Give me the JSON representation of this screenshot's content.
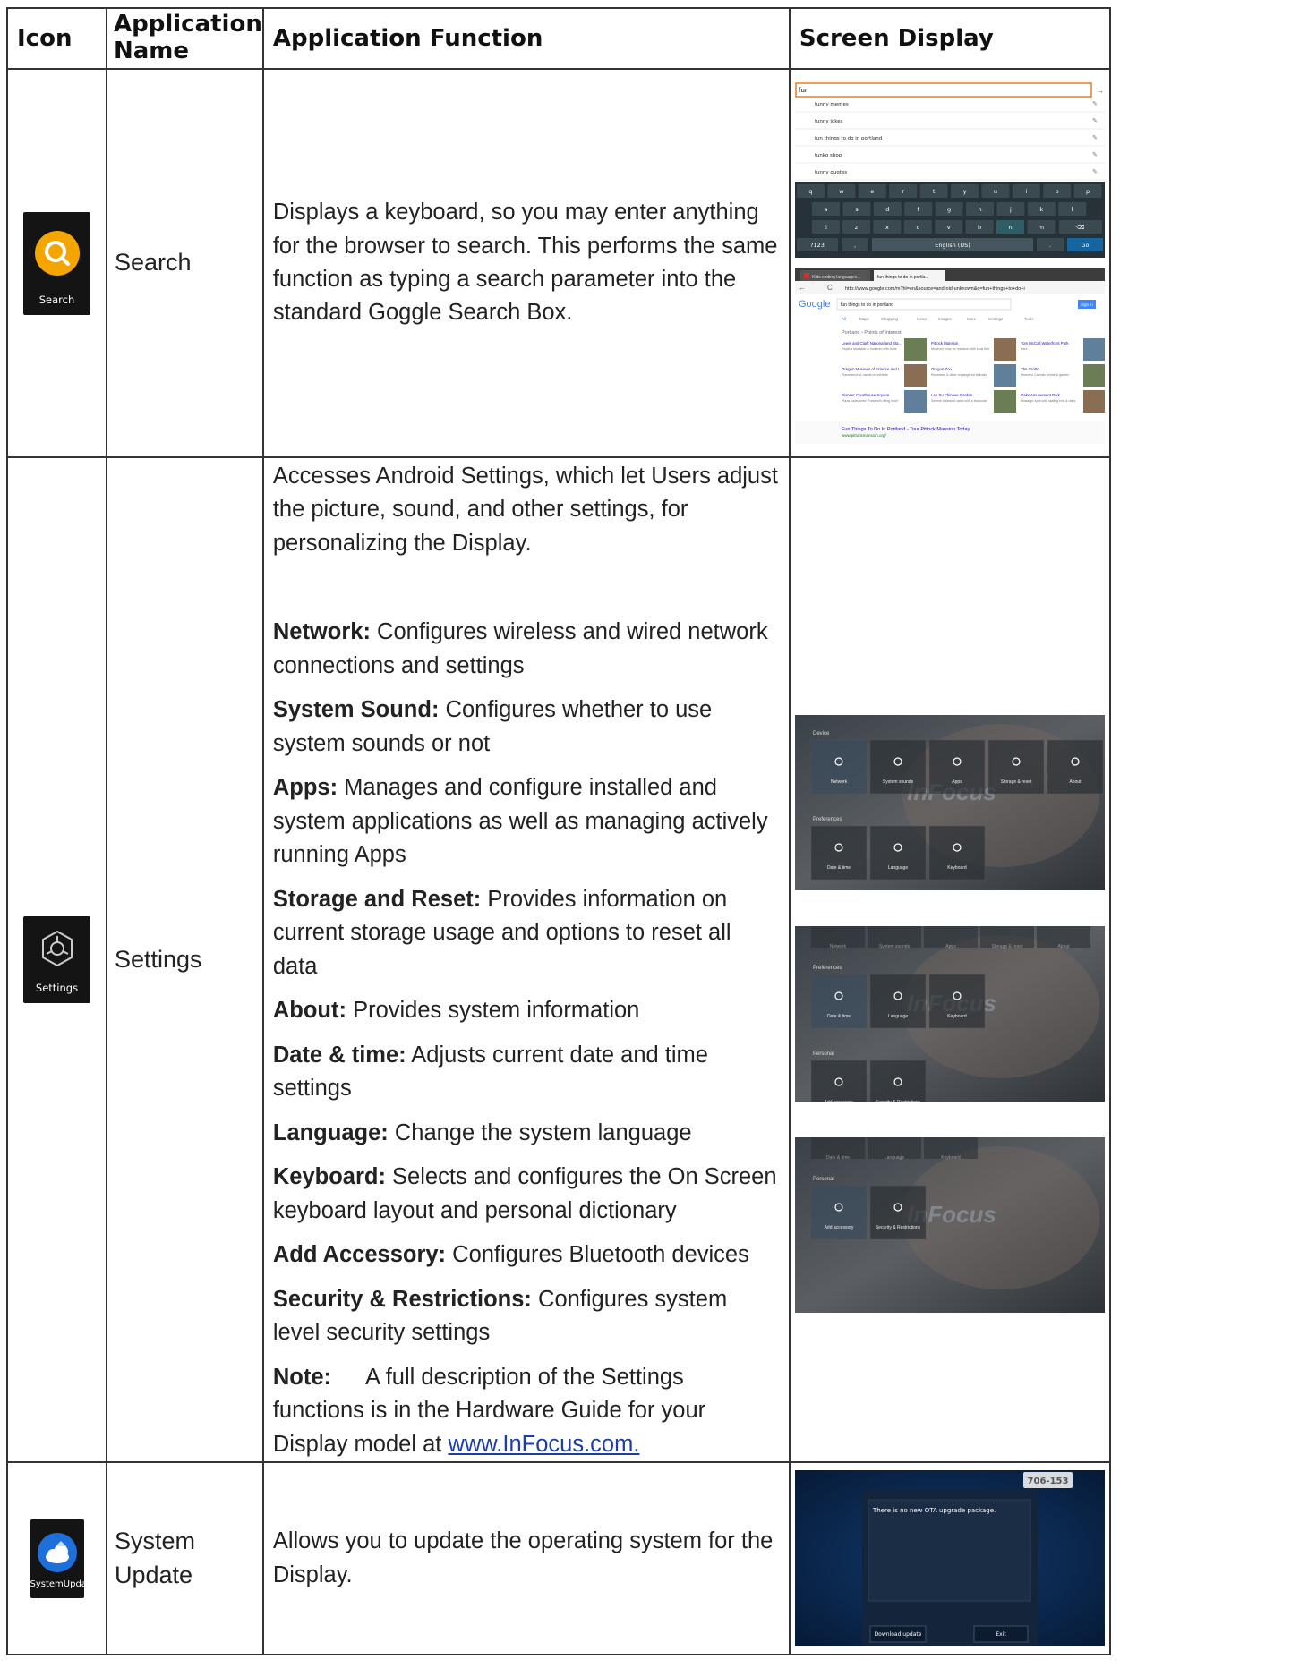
{
  "headers": {
    "icon": "Icon",
    "app_name": "Application Name",
    "function": "Application Function",
    "screen": "Screen Display"
  },
  "search": {
    "icon_label": "Search",
    "name": "Search",
    "function": "Displays a keyboard, so you may enter anything for the browser to search. This performs the same function as typing a search parameter into the standard Goggle Search Box.",
    "kb": {
      "query": "fun",
      "suggestions": [
        "funny memes",
        "funny jokes",
        "fun things to do in portland",
        "funko shop",
        "funny quotes"
      ],
      "row1": [
        "q",
        "w",
        "e",
        "r",
        "t",
        "y",
        "u",
        "i",
        "o",
        "p"
      ],
      "row2": [
        "a",
        "s",
        "d",
        "f",
        "g",
        "h",
        "j",
        "k",
        "l"
      ],
      "row3": [
        "z",
        "x",
        "c",
        "v",
        "b",
        "n",
        "m"
      ],
      "mode_key": "?123",
      "space_label": "English (US)",
      "go_key": "Go"
    },
    "browser": {
      "tab1": "Kids coding languages...",
      "tab2": "fun things to do in portla...",
      "url": "http://www.google.com/m?hl=en&source=android-unknown&q=fun+things+to+do+i",
      "logo": "Google",
      "query": "fun things to do in portland",
      "signin": "Sign in",
      "nav": [
        "All",
        "Maps",
        "Shopping",
        "News",
        "Images",
        "More",
        "Settings",
        "Tools"
      ],
      "breadcrumb": "Portland › Points of Interest",
      "places": [
        {
          "name": "Lewis and Clark National and Sta...",
          "desc": "Replica stockade & museum with trails"
        },
        {
          "name": "Pittock Mansion",
          "desc": "Museum shop for mansion with local flair"
        },
        {
          "name": "Tom McCall Waterfront Park",
          "desc": "Park"
        },
        {
          "name": "Oregon Museum of Science and I...",
          "desc": "Planetarium & hands-on exhibits"
        },
        {
          "name": "Oregon Zoo",
          "desc": "Elephants & other endangered animals"
        },
        {
          "name": "The Grotto",
          "desc": "Peaceful Catholic shrine & garden"
        },
        {
          "name": "Pioneer Courthouse Square",
          "desc": "Plaza nicknamed 'Portland's living room'"
        },
        {
          "name": "Lan Su Chinese Garden",
          "desc": "Serene botanical oasis with a teahouse"
        },
        {
          "name": "Oaks Amusement Park",
          "desc": "Nostalgic spot with skating rink & rides"
        }
      ],
      "result": "Fun Things To Do In Portland - Tour Pittock Mansion Today",
      "result_url": "www.pittockmansion.org/"
    }
  },
  "settings": {
    "icon_label": "Settings",
    "name": "Settings",
    "intro": "Accesses Android Settings, which let Users adjust the picture, sound, and other settings, for personalizing the Display.",
    "items": [
      {
        "term": "Network:",
        "text": "  Configures wireless and wired network connections and settings"
      },
      {
        "term": "System Sound:",
        "text": " Configures whether to use system sounds or not"
      },
      {
        "term": "Apps:",
        "text": " Manages and configure installed and system applications as well as managing actively running Apps"
      },
      {
        "term": "Storage and Reset:",
        "text": " Provides information on current storage usage and options to reset all data"
      },
      {
        "term": "About:",
        "text": "  Provides system information"
      },
      {
        "term": "Date & time:",
        "text": " Adjusts current date and time settings"
      },
      {
        "term": "Language:",
        "text": " Change the system language"
      },
      {
        "term": "Keyboard:",
        "text": "  Selects and configures the On Screen keyboard layout and personal dictionary"
      },
      {
        "term": "Add Accessory:",
        "text": "  Configures Bluetooth devices"
      },
      {
        "term": "Security & Restrictions:",
        "text": " Configures system level security settings"
      }
    ],
    "note_term": "Note:",
    "note_text": "A full description of the Settings functions is in the Hardware Guide for your Display model at ",
    "note_link": "www.InFocus.com.",
    "watermark": "InFocus",
    "screen1": {
      "section1": "Device",
      "tiles": [
        "Network",
        "System sounds",
        "Apps",
        "Storage & reset",
        "About"
      ],
      "section2": "Preferences",
      "tiles2": [
        "Date & time",
        "Language",
        "Keyboard"
      ]
    },
    "screen2": {
      "top": [
        "Network",
        "System sounds",
        "Apps",
        "Storage & reset",
        "About"
      ],
      "section1": "Preferences",
      "tiles": [
        "Date & time",
        "Language",
        "Keyboard"
      ],
      "section2": "Personal",
      "tiles2": [
        "Add accessory",
        "Security & Restrictions"
      ]
    },
    "screen3": {
      "top": [
        "Date & time",
        "Language",
        "Keyboard"
      ],
      "section1": "Personal",
      "tiles": [
        "Add accessory",
        "Security & Restrictions"
      ]
    }
  },
  "update": {
    "icon_label": "SystemUpdate",
    "name": "System Update",
    "function": "Allows you to update the operating system for the Display.",
    "badge": "706-153",
    "message": "There is no new OTA upgrade package.",
    "download": "Download update",
    "exit": "Exit"
  },
  "colors": {
    "search_icon": "#f5a500",
    "update_icon": "#1e6fd9",
    "link": "#1a3fa8",
    "border": "#333333"
  }
}
